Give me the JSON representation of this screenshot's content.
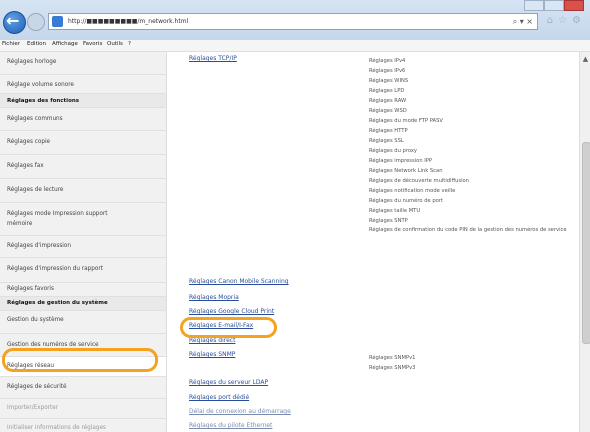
{
  "window": {
    "url": "http://■■■■■■■■■/m_network.html",
    "search_tools": "⌕ ▾ ×"
  },
  "menu": [
    "Fichier",
    "Edition",
    "Affichage",
    "Favoris",
    "Outils",
    "?"
  ],
  "sidebar": {
    "items": [
      {
        "label": "Réglages horloge",
        "kind": "item"
      },
      {
        "label": "Réglage volume sonore",
        "kind": "item"
      },
      {
        "label": "Réglages des fonctions",
        "kind": "header"
      },
      {
        "label": "Réglages communs",
        "kind": "item"
      },
      {
        "label": "Réglages copie",
        "kind": "item"
      },
      {
        "label": "Réglages fax",
        "kind": "item"
      },
      {
        "label": "Réglages de lecture",
        "kind": "item"
      },
      {
        "label": "Réglages mode Impression support",
        "label2": "mémoire",
        "kind": "item"
      },
      {
        "label": "Réglages d'impression",
        "kind": "item"
      },
      {
        "label": "Réglages d'impression du rapport",
        "kind": "item"
      },
      {
        "label": "Réglages favoris",
        "kind": "item"
      },
      {
        "label": "Réglages de gestion du système",
        "kind": "header"
      },
      {
        "label": "Gestion du système",
        "kind": "item"
      },
      {
        "label": "Gestion des numéros de service",
        "kind": "item"
      },
      {
        "label": "Réglages réseau",
        "kind": "item"
      },
      {
        "label": "Réglages de sécurité",
        "kind": "item"
      },
      {
        "label": "Importer/Exporter",
        "kind": "muted"
      },
      {
        "label": "Initialiser informations de réglages",
        "kind": "muted"
      }
    ]
  },
  "content": {
    "links": [
      "Réglages TCP/IP",
      "Réglages Canon Mobile Scanning",
      "Réglages Mopria",
      "Réglages Google Cloud Print",
      "Réglages E-mail/I-Fax",
      "Réglages direct",
      "Réglages SNMP",
      "Réglages du serveur LDAP",
      "Réglages port dédié",
      "Délai de connexion au démarrage",
      "Réglages du pilote Ethernet"
    ],
    "tcpip_subitems": [
      "Réglages IPv4",
      "Réglages IPv6",
      "Réglages WINS",
      "Réglages LPD",
      "Réglages RAW",
      "Réglages WSD",
      "Réglages du mode FTP PASV",
      "Réglages HTTP",
      "Réglages SSL",
      "Réglages du proxy",
      "Réglages impression IPP",
      "Réglages Network Link Scan",
      "Réglages de découverte multidiffusion",
      "Réglages notification mode veille",
      "Réglages du numéro de port",
      "Réglages taille MTU",
      "Réglages SNTP",
      "Réglages de confirmation du code PIN de la gestion des numéros de service"
    ],
    "snmp_subitems": [
      "Réglages SNMPv1",
      "Réglages SNMPv3"
    ]
  },
  "colors": {
    "highlight": "#f3a320",
    "link": "#2a4d9a"
  }
}
